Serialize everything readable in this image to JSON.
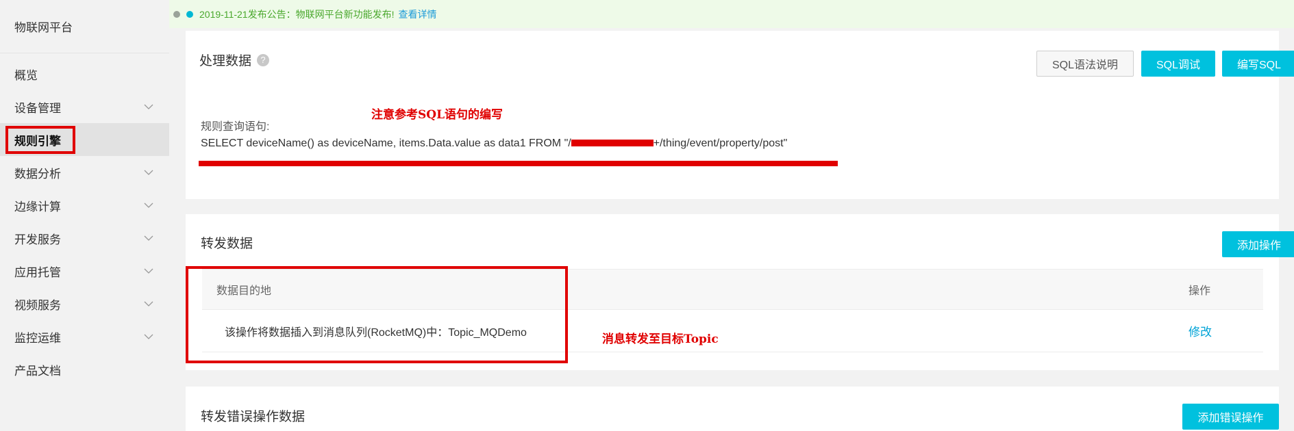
{
  "sidebar": {
    "brand": "物联网平台",
    "items": [
      {
        "label": "概览",
        "has_chevron": false
      },
      {
        "label": "设备管理",
        "has_chevron": true
      },
      {
        "label": "规则引擎",
        "has_chevron": false,
        "active": true
      },
      {
        "label": "数据分析",
        "has_chevron": true
      },
      {
        "label": "边缘计算",
        "has_chevron": true
      },
      {
        "label": "开发服务",
        "has_chevron": true
      },
      {
        "label": "应用托管",
        "has_chevron": true
      },
      {
        "label": "视频服务",
        "has_chevron": true
      },
      {
        "label": "监控运维",
        "has_chevron": true
      },
      {
        "label": "产品文档",
        "has_chevron": false
      }
    ]
  },
  "notice": {
    "text": "2019-11-21发布公告：物联网平台新功能发布!",
    "link": "查看详情"
  },
  "process": {
    "title": "处理数据",
    "help_icon": "question-circle-icon",
    "buttons": {
      "sql_syntax": "SQL语法说明",
      "sql_debug": "SQL调试",
      "write_sql": "编写SQL"
    },
    "annotation": "注意参考SQL语句的编写",
    "query_label": "规则查询语句:",
    "sql_prefix": "SELECT deviceName() as deviceName, items.Data.value as data1 FROM \"/",
    "sql_suffix": "+/thing/event/property/post\""
  },
  "forward": {
    "title": "转发数据",
    "add_button": "添加操作",
    "columns": {
      "dest": "数据目的地",
      "op": "操作"
    },
    "rows": [
      {
        "dest": "该操作将数据插入到消息队列(RocketMQ)中：Topic_MQDemo",
        "op": "修改"
      }
    ],
    "annotation": "消息转发至目标Topic"
  },
  "error_forward": {
    "title": "转发错误操作数据",
    "add_button": "添加错误操作"
  },
  "colors": {
    "accent": "#00c1de",
    "annotation_red": "#e00000",
    "notice_green": "#4aa82d"
  }
}
